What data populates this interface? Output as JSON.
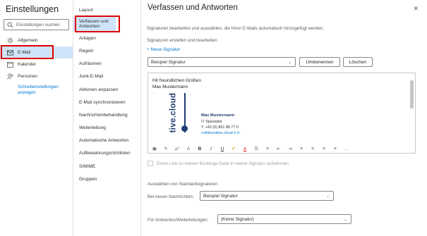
{
  "settings": {
    "title": "Einstellungen",
    "search_placeholder": "Einstellungen suchen",
    "nav": [
      {
        "label": "Allgemein"
      },
      {
        "label": "E-Mail"
      },
      {
        "label": "Kalender"
      },
      {
        "label": "Personen"
      }
    ],
    "quick_link": "Schnelleinstellungen anzeigen"
  },
  "mail_menu": {
    "items": [
      "Layout",
      "Verfassen und Antworten",
      "Anlagen",
      "Regeln",
      "Aufräumen",
      "Junk-E-Mail",
      "Aktionen anpassen",
      "E-Mail synchronisieren",
      "Nachrichtenbehandlung",
      "Weiterleitung",
      "Automatische Antworten",
      "Aufbewahrungsrichtlinien",
      "S/MIME",
      "Gruppen"
    ]
  },
  "main": {
    "title": "Verfassen und Antworten",
    "close": "✕",
    "description": "Signaturen bearbeiten und auswählen, die Ihren E-Mails automatisch hinzugefügt werden.",
    "section_label": "Signaturen erstellen und bearbeiten",
    "new_signature": "+ Neue Signatur",
    "signature_select": "Beispiel Signatur",
    "rename_button": "Umbenennen",
    "delete_button": "Löschen",
    "editor": {
      "greeting": "Hit freundlichen Grüßen",
      "name_line": "Max Mustermann",
      "dash": "-",
      "logo_text": "tive.cloud",
      "sig_name": "Max Mustermann",
      "sig_role": "IT Spezialist",
      "sig_phone": "T:  +43 (0) 861 88 77 0",
      "sig_site": "collaborative.cloud e.U."
    },
    "bookings_checkbox": "Einen Link zu meiner Bookings-Seite in meine Signatur aufnehmen",
    "defaults_label": "Auswählen von Standardsignaturen",
    "new_messages_label": "Bei neuen Nachrichten:",
    "new_messages_value": "Beispiel Signatur",
    "replies_label": "Für Antworten/Weiterleitungen:",
    "replies_value": "(Keine Signatur)"
  },
  "colors": {
    "accent": "#0078d4",
    "highlight": "#e00000",
    "active_bg": "#cfe4fa",
    "logo": "#1f3e73"
  }
}
